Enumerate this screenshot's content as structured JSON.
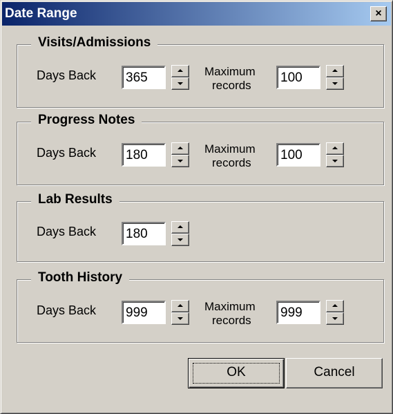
{
  "window": {
    "title": "Date Range",
    "close_glyph": "×"
  },
  "visits": {
    "label": "Visits/Admissions",
    "days_back_label": "Days Back",
    "days_back_value": "365",
    "max_label_line1": "Maximum",
    "max_label_line2": "records",
    "max_value": "100"
  },
  "progress": {
    "label": "Progress Notes",
    "days_back_label": "Days Back",
    "days_back_value": "180",
    "max_label_line1": "Maximum",
    "max_label_line2": "records",
    "max_value": "100"
  },
  "lab": {
    "label": "Lab Results",
    "days_back_label": "Days Back",
    "days_back_value": "180"
  },
  "tooth": {
    "label": "Tooth History",
    "days_back_label": "Days Back",
    "days_back_value": "999",
    "max_label_line1": "Maximum",
    "max_label_line2": "records",
    "max_value": "999"
  },
  "buttons": {
    "ok": "OK",
    "cancel": "Cancel"
  }
}
